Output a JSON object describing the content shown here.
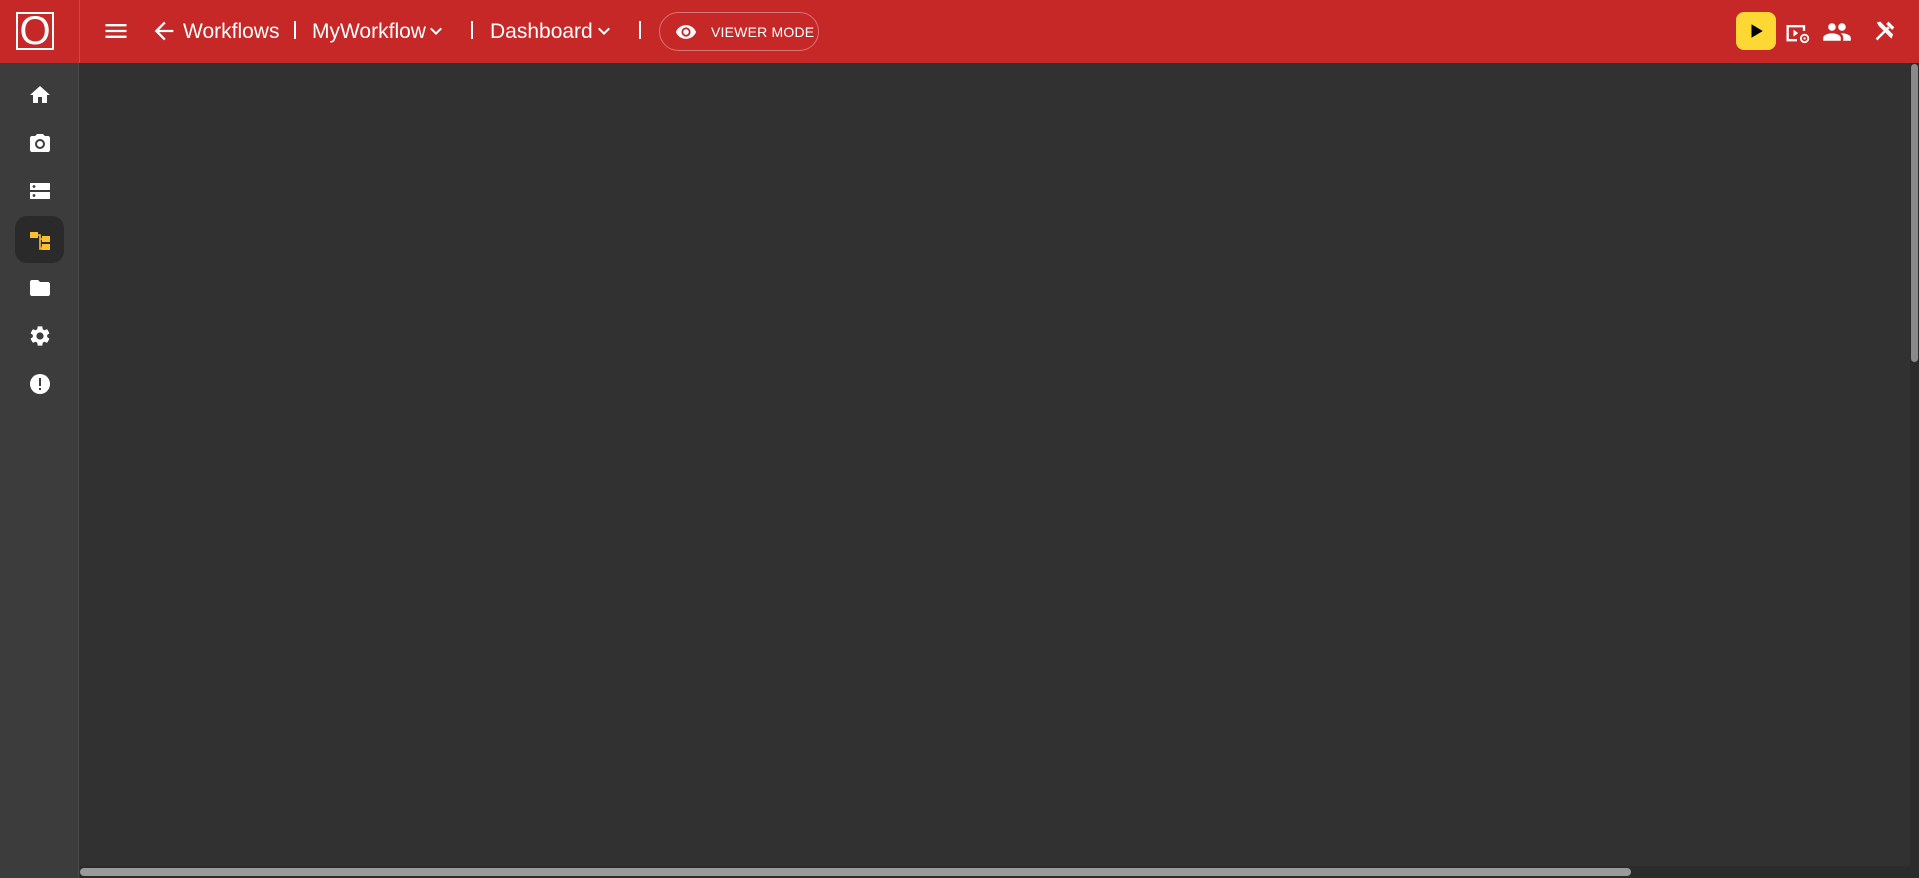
{
  "app": {
    "logo_letter": "O"
  },
  "header": {
    "menu_icon": "hamburger-menu-icon",
    "back_icon": "arrow-left-icon",
    "breadcrumb_root": "Workflows",
    "separator": "|",
    "workflow_name": "MyWorkflow",
    "view_name": "Dashboard",
    "mode_label": "VIEWER MODE",
    "mode_icon": "eye-icon",
    "actions": [
      {
        "name": "run",
        "icon": "play-icon",
        "color": "#fdd835"
      },
      {
        "name": "preview-settings",
        "icon": "video-settings-icon"
      },
      {
        "name": "users",
        "icon": "people-icon"
      },
      {
        "name": "tools",
        "icon": "tools-icon"
      }
    ]
  },
  "sidebar": {
    "items": [
      {
        "name": "home",
        "icon": "home-icon",
        "active": false
      },
      {
        "name": "camera",
        "icon": "camera-icon",
        "active": false
      },
      {
        "name": "storage",
        "icon": "storage-icon",
        "active": false
      },
      {
        "name": "workflows",
        "icon": "workflow-tree-icon",
        "active": true
      },
      {
        "name": "files",
        "icon": "folder-icon",
        "active": false
      },
      {
        "name": "settings",
        "icon": "gear-icon",
        "active": false
      },
      {
        "name": "alerts",
        "icon": "alert-circle-icon",
        "active": false
      }
    ]
  },
  "colors": {
    "header_bg": "#c62828",
    "sidebar_bg": "#3c3c3c",
    "canvas_bg": "#313131",
    "accent": "#fdd835",
    "active_icon": "#fbc02d"
  }
}
